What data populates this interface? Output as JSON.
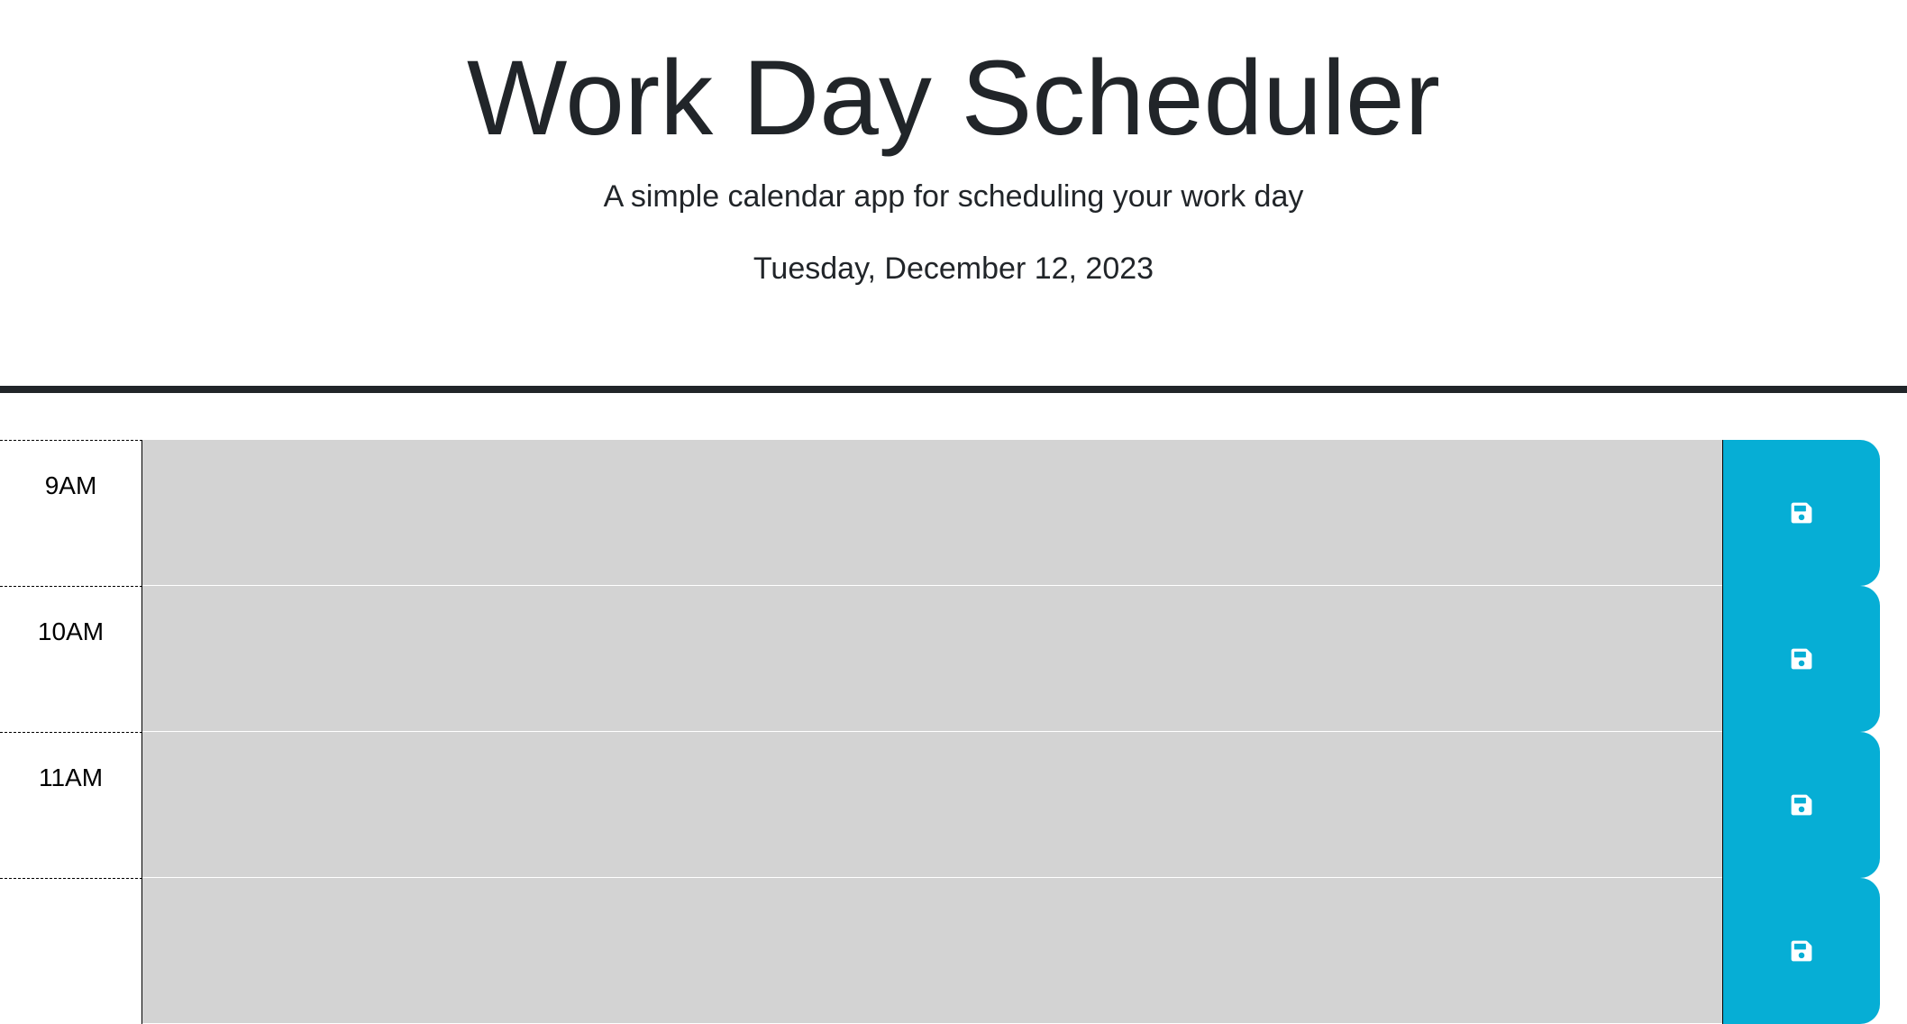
{
  "header": {
    "title": "Work Day Scheduler",
    "subtitle": "A simple calendar app for scheduling your work day",
    "current_day": "Tuesday, December 12, 2023"
  },
  "colors": {
    "past": "#d3d3d3",
    "save_button": "#06aed5",
    "divider": "#212529"
  },
  "time_blocks": [
    {
      "hour": "9AM",
      "description": "",
      "state": "past",
      "save_icon": "floppy-disk-icon"
    },
    {
      "hour": "10AM",
      "description": "",
      "state": "past",
      "save_icon": "floppy-disk-icon"
    },
    {
      "hour": "11AM",
      "description": "",
      "state": "past",
      "save_icon": "floppy-disk-icon"
    },
    {
      "hour": "",
      "description": "",
      "state": "past",
      "save_icon": "floppy-disk-icon"
    }
  ]
}
